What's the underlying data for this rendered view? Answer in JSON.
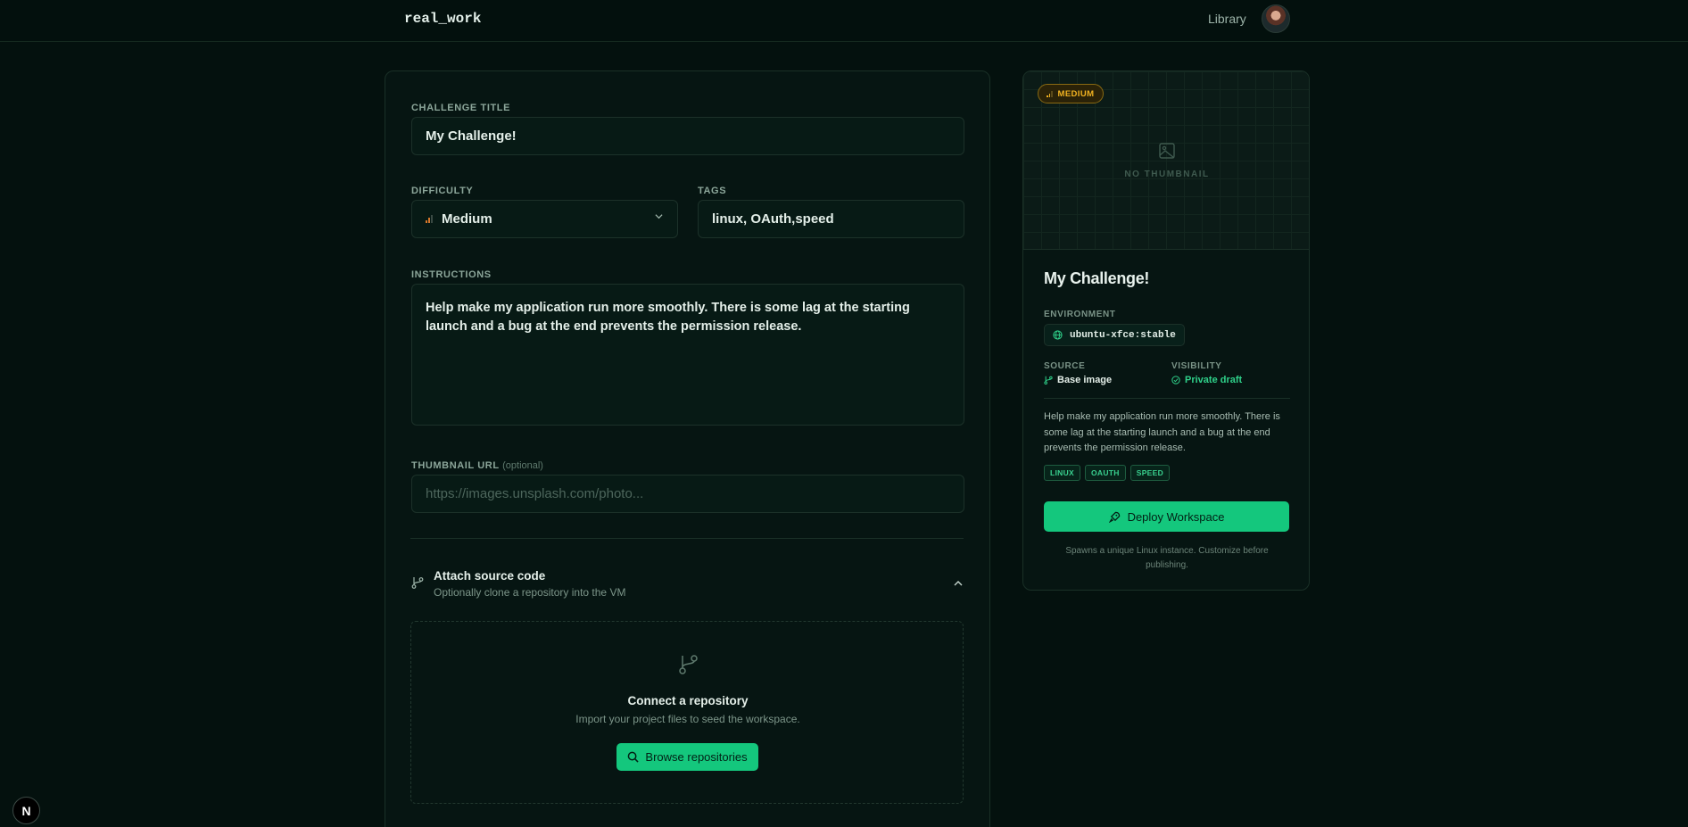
{
  "header": {
    "brand": "real_work",
    "nav_library": "Library"
  },
  "form": {
    "title_label": "CHALLENGE TITLE",
    "title_value": "My Challenge!",
    "difficulty_label": "DIFFICULTY",
    "difficulty_value": "Medium",
    "tags_label": "TAGS",
    "tags_value": "linux, OAuth,speed",
    "instructions_label": "INSTRUCTIONS",
    "instructions_value": "Help make my application run more smoothly. There is some lag at the starting launch and a bug at the end prevents the permission release.",
    "thumbnail_label": "THUMBNAIL URL",
    "thumbnail_optional": "(optional)",
    "thumbnail_placeholder": "https://images.unsplash.com/photo...",
    "attach_title": "Attach source code",
    "attach_subtitle": "Optionally clone a repository into the VM",
    "repo_title": "Connect a repository",
    "repo_subtitle": "Import your project files to seed the workspace.",
    "browse_label": "Browse repositories"
  },
  "preview": {
    "badge": "MEDIUM",
    "no_thumbnail": "NO THUMBNAIL",
    "title": "My Challenge!",
    "environment_label": "ENVIRONMENT",
    "environment_value": "ubuntu-xfce:stable",
    "source_label": "SOURCE",
    "source_value": "Base image",
    "visibility_label": "VISIBILITY",
    "visibility_value": "Private draft",
    "description": "Help make my application run more smoothly. There is some lag at the starting launch and a bug at the end prevents the permission release.",
    "tags": [
      "LINUX",
      "OAUTH",
      "SPEED"
    ],
    "deploy_label": "Deploy Workspace",
    "note": "Spawns a unique Linux instance. Customize before publishing."
  },
  "dev_badge": "N",
  "colors": {
    "accent": "#14c77d",
    "background": "#04110e",
    "medium_badge": "#f2b321",
    "difficulty_icon": "#d7772b"
  },
  "icons": {
    "difficulty": "signal-bars-icon",
    "dropdown": "chevron-down-icon",
    "attach": "git-branch-icon",
    "collapse": "chevron-up-icon",
    "repo": "git-branch-icon",
    "browse": "search-icon",
    "thumbnail": "image-icon",
    "environment": "globe-icon",
    "source": "git-branch-icon",
    "visibility": "check-circle-icon",
    "deploy": "rocket-icon"
  }
}
